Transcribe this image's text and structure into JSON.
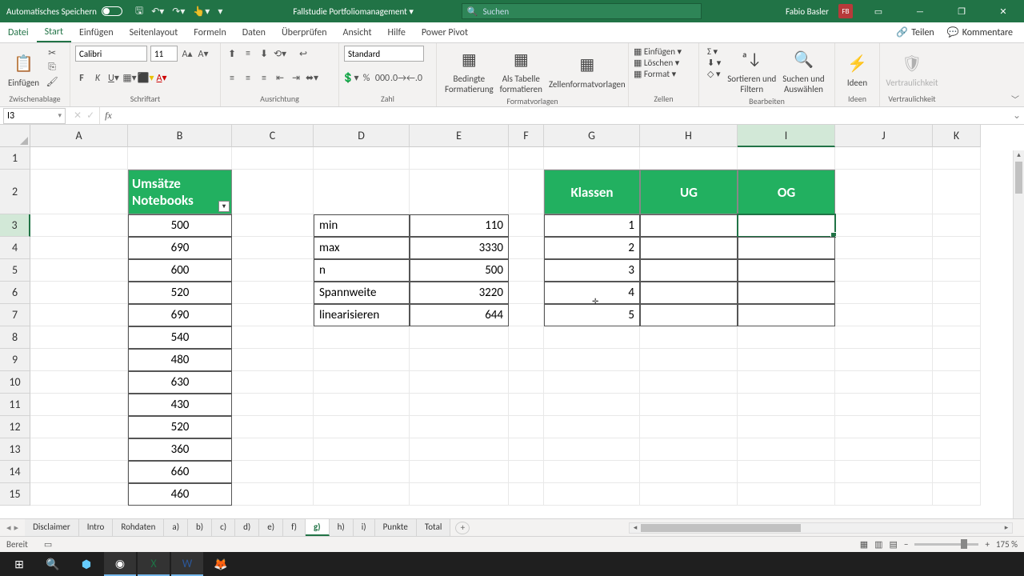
{
  "title": {
    "autosave": "Automatisches Speichern",
    "document": "Fallstudie Portfoliomanagement",
    "search_placeholder": "Suchen",
    "user": "Fabio Basler",
    "user_initials": "FB"
  },
  "tabs": {
    "file": "Datei",
    "start": "Start",
    "insert": "Einfügen",
    "pagelayout": "Seitenlayout",
    "formulas": "Formeln",
    "data": "Daten",
    "review": "Überprüfen",
    "view": "Ansicht",
    "help": "Hilfe",
    "powerpivot": "Power Pivot",
    "share": "Teilen",
    "comments": "Kommentare"
  },
  "ribbon": {
    "clipboard": {
      "paste": "Einfügen",
      "label": "Zwischenablage"
    },
    "font": {
      "name": "Calibri",
      "size": "11",
      "label": "Schriftart"
    },
    "align": {
      "label": "Ausrichtung"
    },
    "number": {
      "format": "Standard",
      "label": "Zahl"
    },
    "styles": {
      "cond": "Bedingte\nFormatierung",
      "table": "Als Tabelle\nformatieren",
      "cell": "Zellenformatvorlagen",
      "label": "Formatvorlagen"
    },
    "cells": {
      "insert": "Einfügen",
      "delete": "Löschen",
      "format": "Format",
      "label": "Zellen"
    },
    "editing": {
      "sort": "Sortieren und\nFiltern",
      "find": "Suchen und\nAuswählen",
      "label": "Bearbeiten"
    },
    "ideas": {
      "btn": "Ideen",
      "label": "Ideen"
    },
    "sens": {
      "btn": "Vertraulichkeit",
      "label": "Vertraulichkeit"
    }
  },
  "namebox": "I3",
  "columns": [
    "A",
    "B",
    "C",
    "D",
    "E",
    "F",
    "G",
    "H",
    "I",
    "J",
    "K"
  ],
  "rows": [
    "1",
    "2",
    "3",
    "4",
    "5",
    "6",
    "7",
    "8",
    "9",
    "10",
    "11",
    "12",
    "13",
    "14",
    "15"
  ],
  "headers": {
    "b2": "Umsätze Notebooks",
    "g2": "Klassen",
    "h2": "UG",
    "i2": "OG"
  },
  "bcol": [
    "500",
    "690",
    "600",
    "520",
    "690",
    "540",
    "480",
    "630",
    "430",
    "520",
    "360",
    "660",
    "460"
  ],
  "dlabels": [
    "min",
    "max",
    "n",
    "Spannweite",
    "linearisieren"
  ],
  "evals": [
    "110",
    "3330",
    "500",
    "3220",
    "644"
  ],
  "gvals": [
    "1",
    "2",
    "3",
    "4",
    "5"
  ],
  "sheets": [
    "Disclaimer",
    "Intro",
    "Rohdaten",
    "a)",
    "b)",
    "c)",
    "d)",
    "e)",
    "f)",
    "g)",
    "h)",
    "i)",
    "Punkte",
    "Total"
  ],
  "active_sheet": "g)",
  "status": "Bereit",
  "zoom": "175 %",
  "chart_data": null
}
